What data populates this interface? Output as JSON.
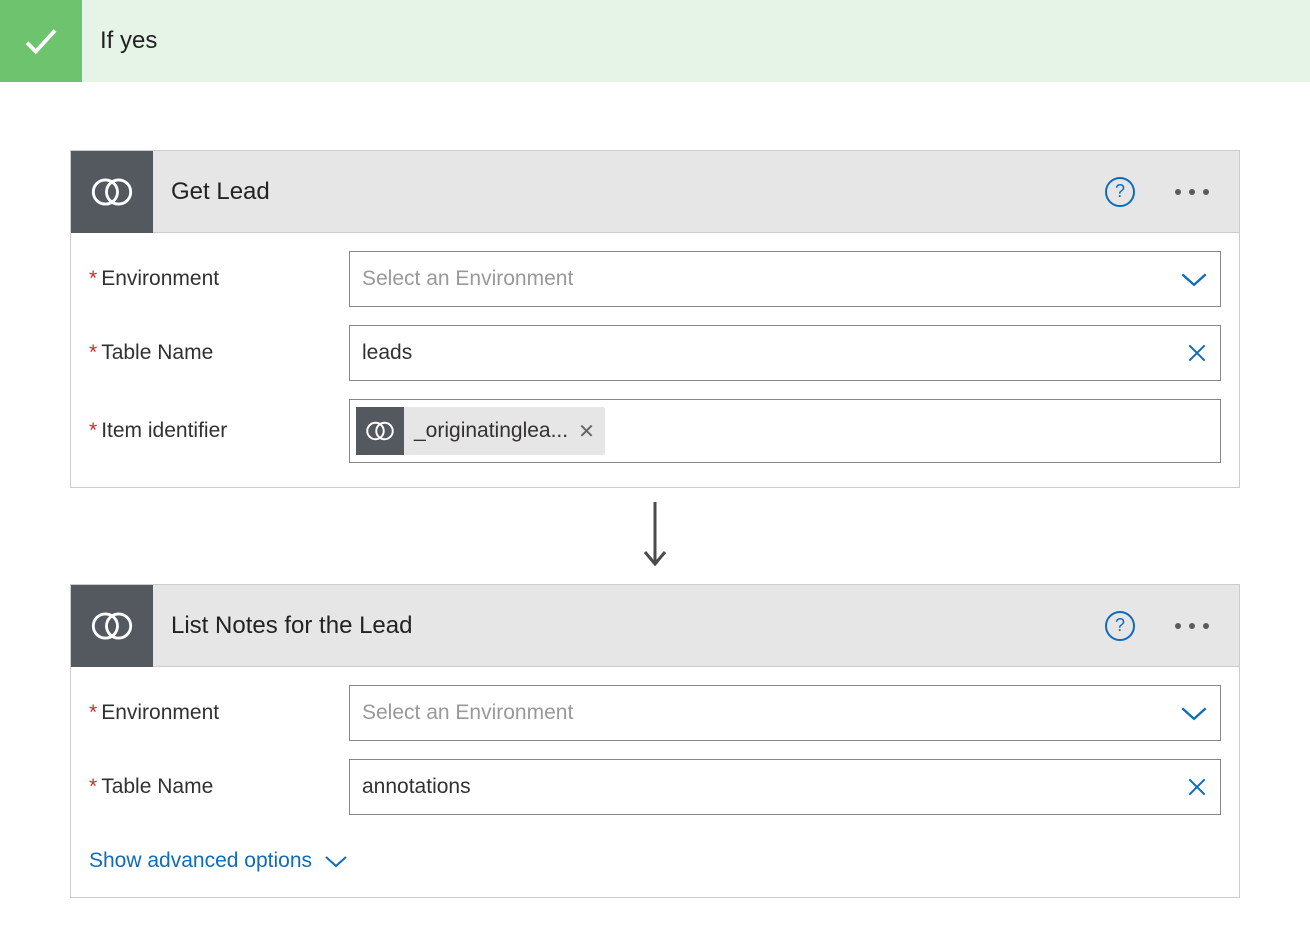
{
  "condition": {
    "label": "If yes"
  },
  "labels": {
    "environment": "Environment",
    "table_name": "Table Name",
    "item_identifier": "Item identifier",
    "show_advanced": "Show advanced options"
  },
  "placeholders": {
    "select_environment": "Select an Environment"
  },
  "cards": {
    "get_lead": {
      "title": "Get Lead",
      "table_name_value": "leads",
      "token_label": "_originatinglea..."
    },
    "list_notes": {
      "title": "List Notes for the Lead",
      "table_name_value": "annotations"
    }
  }
}
